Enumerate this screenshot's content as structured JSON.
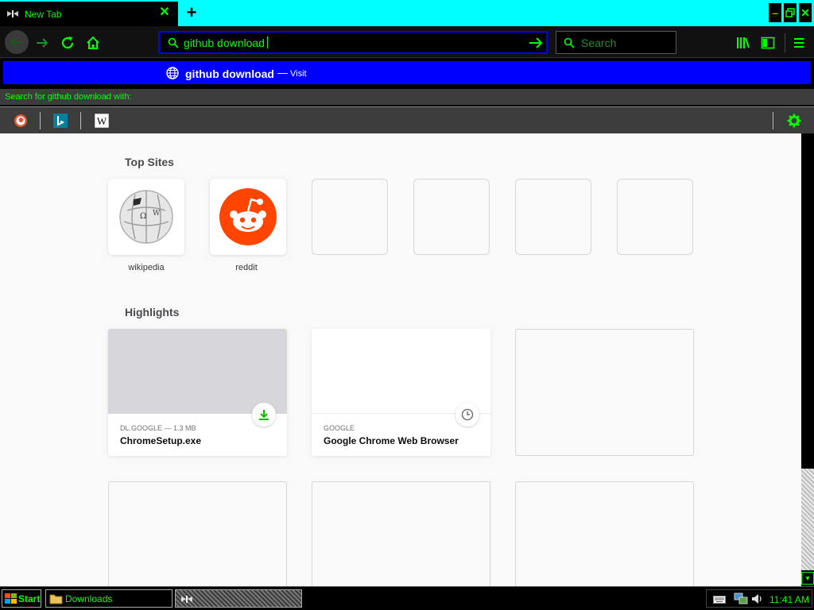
{
  "tab": {
    "title": "New Tab",
    "favicon": "moth-icon",
    "close": "close-tab-icon"
  },
  "new_tab_label": "+",
  "window_controls": [
    "minimize-icon",
    "restore-icon",
    "close-icon"
  ],
  "nav": {
    "back_icon": "back-arrow-icon",
    "forward_icon": "forward-arrow-icon",
    "reload_icon": "reload-icon",
    "home_icon": "home-icon",
    "url_value": "github download",
    "go_icon": "go-arrow-icon",
    "search_placeholder": "Search",
    "library_icon": "library-icon",
    "sidebar_icon": "sidebar-icon",
    "menu_icon": "hamburger-menu-icon"
  },
  "autocomplete": {
    "suggestion_main": "github download",
    "suggestion_dash": "—",
    "suggestion_action": "Visit",
    "search_with_label": "Search for github download  with:",
    "engines": [
      "duckduckgo-icon",
      "bing-icon",
      "wikipedia-icon"
    ],
    "settings_icon": "gear-icon"
  },
  "top_sites": {
    "title": "Top Sites",
    "items": [
      {
        "label": "wikipedia",
        "icon": "wikipedia-globe-icon"
      },
      {
        "label": "reddit",
        "icon": "reddit-icon"
      }
    ]
  },
  "highlights": {
    "title": "Highlights",
    "cards": [
      {
        "context": "DL.GOOGLE — 1.3 MB",
        "title": "ChromeSetup.exe",
        "badge": "download-icon"
      },
      {
        "context": "GOOGLE",
        "title": "Google Chrome Web Browser",
        "badge": "clock-icon"
      }
    ]
  },
  "taskbar": {
    "start": "Start",
    "tasks": [
      {
        "label": "Downloads",
        "icon": "folder-icon"
      },
      {
        "label": "",
        "icon": "browser-icon"
      }
    ],
    "clock": "11:41 AM"
  },
  "colors": {
    "accent": "#00ff00",
    "tabstrip": "#00ffff",
    "selection": "#0000ff",
    "reddit": "#ff4500"
  }
}
